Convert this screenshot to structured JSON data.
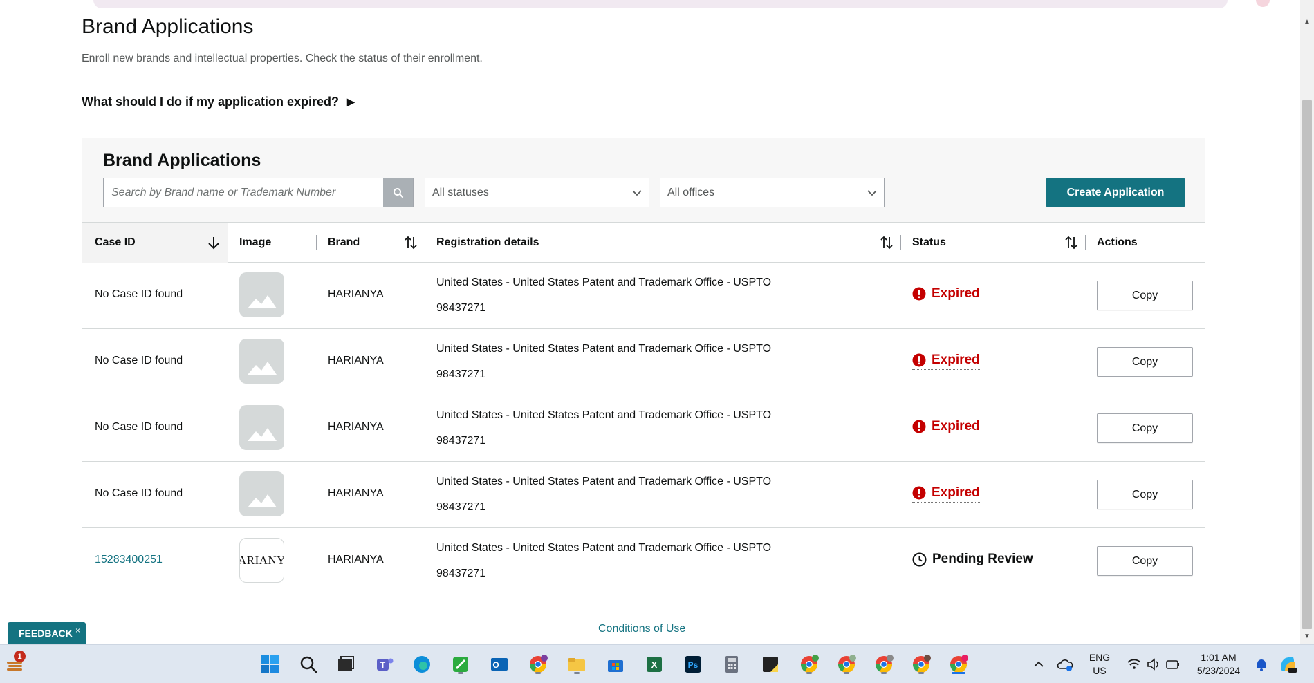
{
  "page": {
    "title": "Brand Applications",
    "subtitle": "Enroll new brands and intellectual properties. Check the status of their enrollment.",
    "faq": "What should I do if my application expired?"
  },
  "panel": {
    "title": "Brand Applications",
    "search_placeholder": "Search by Brand name or Trademark Number",
    "status_filter": "All statuses",
    "office_filter": "All offices",
    "create_button": "Create Application"
  },
  "table": {
    "headers": {
      "case_id": "Case ID",
      "image": "Image",
      "brand": "Brand",
      "registration": "Registration details",
      "status": "Status",
      "actions": "Actions"
    },
    "rows": [
      {
        "case_id": "No Case ID found",
        "brand": "HARIANYA",
        "reg_office": "United States - United States Patent and Trademark Office - USPTO",
        "reg_number": "98437271",
        "status": "Expired",
        "action": "Copy"
      },
      {
        "case_id": "No Case ID found",
        "brand": "HARIANYA",
        "reg_office": "United States - United States Patent and Trademark Office - USPTO",
        "reg_number": "98437271",
        "status": "Expired",
        "action": "Copy"
      },
      {
        "case_id": "No Case ID found",
        "brand": "HARIANYA",
        "reg_office": "United States - United States Patent and Trademark Office - USPTO",
        "reg_number": "98437271",
        "status": "Expired",
        "action": "Copy"
      },
      {
        "case_id": "No Case ID found",
        "brand": "HARIANYA",
        "reg_office": "United States - United States Patent and Trademark Office - USPTO",
        "reg_number": "98437271",
        "status": "Expired",
        "action": "Copy"
      },
      {
        "case_id": "15283400251",
        "brand": "HARIANYA",
        "logo_text": "ARIANY",
        "reg_office": "United States - United States Patent and Trademark Office - USPTO",
        "reg_number": "98437271",
        "status": "Pending Review",
        "action": "Copy"
      }
    ]
  },
  "footer": {
    "conditions": "Conditions of Use",
    "feedback": "FEEDBACK",
    "feedback_close": "×"
  },
  "taskbar": {
    "weather_badge": "1",
    "language_line1": "ENG",
    "language_line2": "US",
    "time": "1:01 AM",
    "date": "5/23/2024"
  },
  "colors": {
    "accent": "#147381",
    "expired": "#c40000"
  }
}
